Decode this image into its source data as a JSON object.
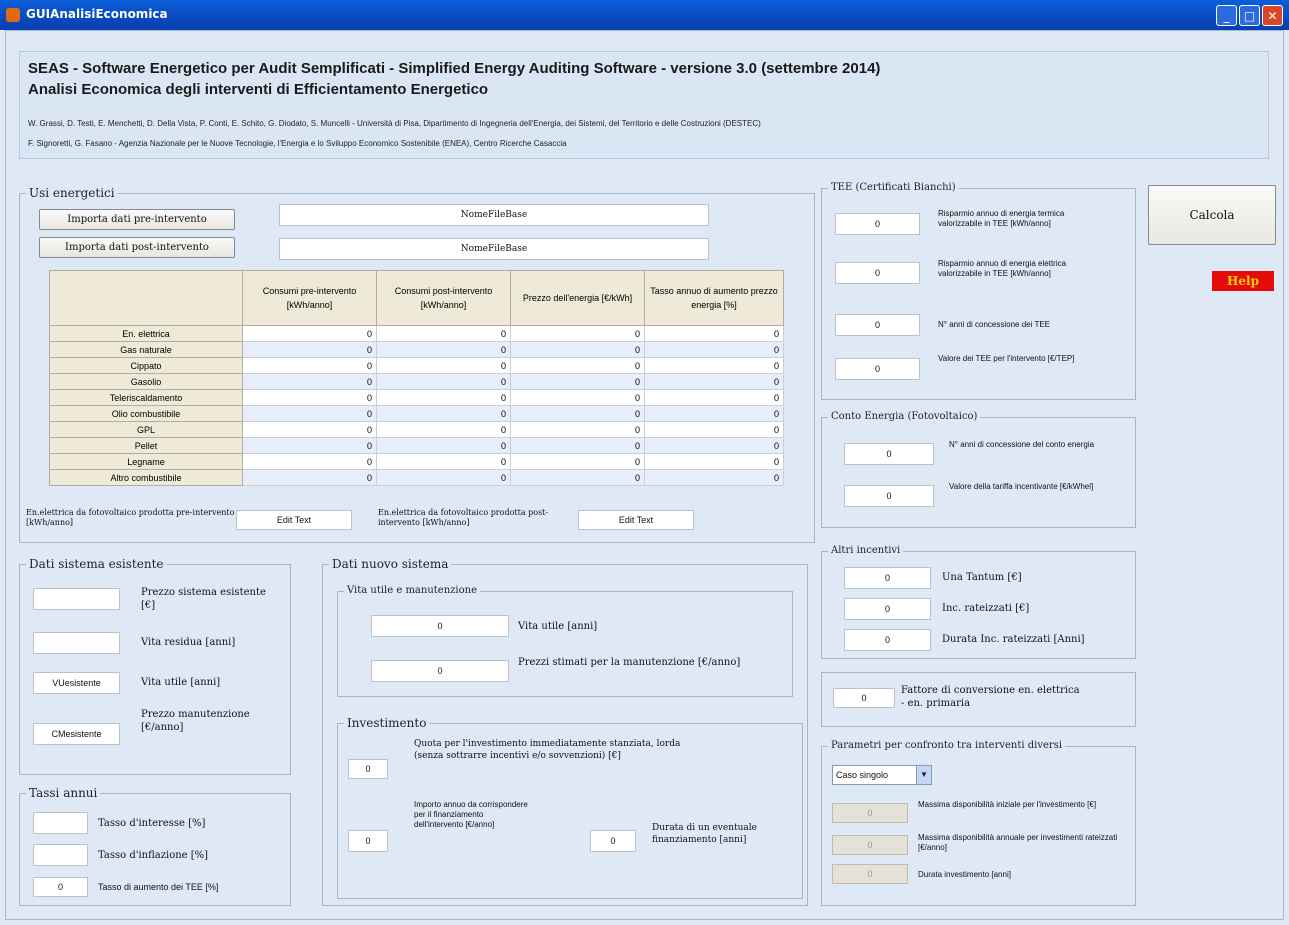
{
  "window": {
    "title": "GUIAnalisiEconomica"
  },
  "header": {
    "line1": "SEAS - Software Energetico per Audit Semplificati - Simplified Energy Auditing Software - versione 3.0 (settembre 2014)",
    "line2": "Analisi Economica degli interventi di Efficientamento Energetico",
    "authors1": "W. Grassi, D. Testi, E. Menchetti, D. Della Vista, P. Conti, E. Schito, G. Diodato, S. Muncelli - Università di Pisa, Dipartimento di Ingegneria dell'Energia, dei Sistemi, del Territorio e delle Costruzioni (DESTEC)",
    "authors2": "F. Signoretti, G. Fasano - Agenzia Nazionale per le Nuove Tecnologie, l'Energia e lo Sviluppo Economico Sostenibile (ENEA), Centro Ricerche Casaccia"
  },
  "usi": {
    "title": "Usi energetici",
    "import_pre": "Importa dati pre-intervento",
    "import_post": "Importa dati post-intervento",
    "file_pre": "NomeFileBase",
    "file_post": "NomeFileBase",
    "columns": [
      "Consumi pre-intervento [kWh/anno]",
      "Consumi post-intervento [kWh/anno]",
      "Prezzo dell'energia [€/kWh]",
      "Tasso annuo di aumento prezzo energia [%]"
    ],
    "rows": [
      {
        "label": "En. elettrica",
        "values": [
          "0",
          "0",
          "0",
          "0"
        ]
      },
      {
        "label": "Gas naturale",
        "values": [
          "0",
          "0",
          "0",
          "0"
        ]
      },
      {
        "label": "Cippato",
        "values": [
          "0",
          "0",
          "0",
          "0"
        ]
      },
      {
        "label": "Gasolio",
        "values": [
          "0",
          "0",
          "0",
          "0"
        ]
      },
      {
        "label": "Teleriscaldamento",
        "values": [
          "0",
          "0",
          "0",
          "0"
        ]
      },
      {
        "label": "Olio combustibile",
        "values": [
          "0",
          "0",
          "0",
          "0"
        ]
      },
      {
        "label": "GPL",
        "values": [
          "0",
          "0",
          "0",
          "0"
        ]
      },
      {
        "label": "Pellet",
        "values": [
          "0",
          "0",
          "0",
          "0"
        ]
      },
      {
        "label": "Legname",
        "values": [
          "0",
          "0",
          "0",
          "0"
        ]
      },
      {
        "label": "Altro combustibile",
        "values": [
          "0",
          "0",
          "0",
          "0"
        ]
      }
    ],
    "fv_pre_label": "En.elettrica da fotovoltaico prodotta pre-intervento [kWh/anno]",
    "fv_pre_value": "Edit Text",
    "fv_post_label": "En.elettrica da fotovoltaico prodotta post-intervento [kWh/anno]",
    "fv_post_value": "Edit Text"
  },
  "esistente": {
    "title": "Dati sistema esistente",
    "prezzo_label": "Prezzo sistema esistente [€]",
    "prezzo_value": "",
    "vita_res_label": "Vita residua [anni]",
    "vita_res_value": "",
    "vita_utile_label": "Vita utile [anni]",
    "vita_utile_value": "VUesistente",
    "manut_label": "Prezzo manutenzione [€/anno]",
    "manut_value": "CMesistente"
  },
  "tassi": {
    "title": "Tassi annui",
    "interesse_label": "Tasso d'interesse [%]",
    "interesse_value": "",
    "inflazione_label": "Tasso d'inflazione [%]",
    "inflazione_value": "",
    "tee_label": "Tasso di aumento dei TEE [%]",
    "tee_value": "0"
  },
  "nuovo": {
    "title": "Dati nuovo sistema",
    "vita_group": "Vita utile e manutenzione",
    "vita_label": "Vita utile [anni]",
    "vita_value": "0",
    "manut_label": "Prezzi stimati per la manutenzione [€/anno]",
    "manut_value": "0",
    "inv_group": "Investimento",
    "quota_label": "Quota per l'investimento immediatamente stanziata, lorda (senza sottrarre incentivi e/o sovvenzioni) [€]",
    "quota_value": "0",
    "importo_label": "Importo annuo da corrispondere per il finanziamento dell'intervento [€/anno]",
    "importo_value": "0",
    "durata_label": "Durata di un eventuale finanziamento [anni]",
    "durata_value": "0"
  },
  "tee": {
    "title": "TEE (Certificati Bianchi)",
    "items": [
      {
        "label": "Risparmio annuo di energia termica valorizzabile in TEE [kWh/anno]",
        "value": "0"
      },
      {
        "label": "Risparmio annuo di energia elettrica valorizzabile in TEE [kWh/anno]",
        "value": "0"
      },
      {
        "label": "N° anni di concessione dei TEE",
        "value": "0"
      },
      {
        "label": "Valore dei TEE per l'intervento [€/TEP]",
        "value": "0"
      }
    ]
  },
  "conto": {
    "title": "Conto Energia (Fotovoltaico)",
    "anni_label": "N° anni di concessione del conto energia",
    "anni_value": "0",
    "tariffa_label": "Valore della tariffa incentivante [€/kWhel]",
    "tariffa_value": "0"
  },
  "altri": {
    "title": "Altri incentivi",
    "tantum_label": "Una Tantum [€]",
    "tantum_value": "0",
    "rateizzati_label": "Inc. rateizzati [€]",
    "rateizzati_value": "0",
    "durata_label": "Durata Inc. rateizzati [Anni]",
    "durata_value": "0"
  },
  "fattore": {
    "label": "Fattore di conversione en. elettrica - en. primaria",
    "value": "0"
  },
  "parametri": {
    "title": "Parametri per confronto tra interventi diversi",
    "select_value": "Caso singolo",
    "max_disp_label": "Massima disponibilità iniziale per l'investimento [€]",
    "max_annua_label": "Massima disponibilità annuale per investimenti rateizzati [€/anno]",
    "durata_label": "Durata investimento [anni]",
    "max_disp_value": "0",
    "max_annua_value": "0",
    "durata_value": "0"
  },
  "actions": {
    "calcola": "Calcola",
    "help": "Help"
  }
}
